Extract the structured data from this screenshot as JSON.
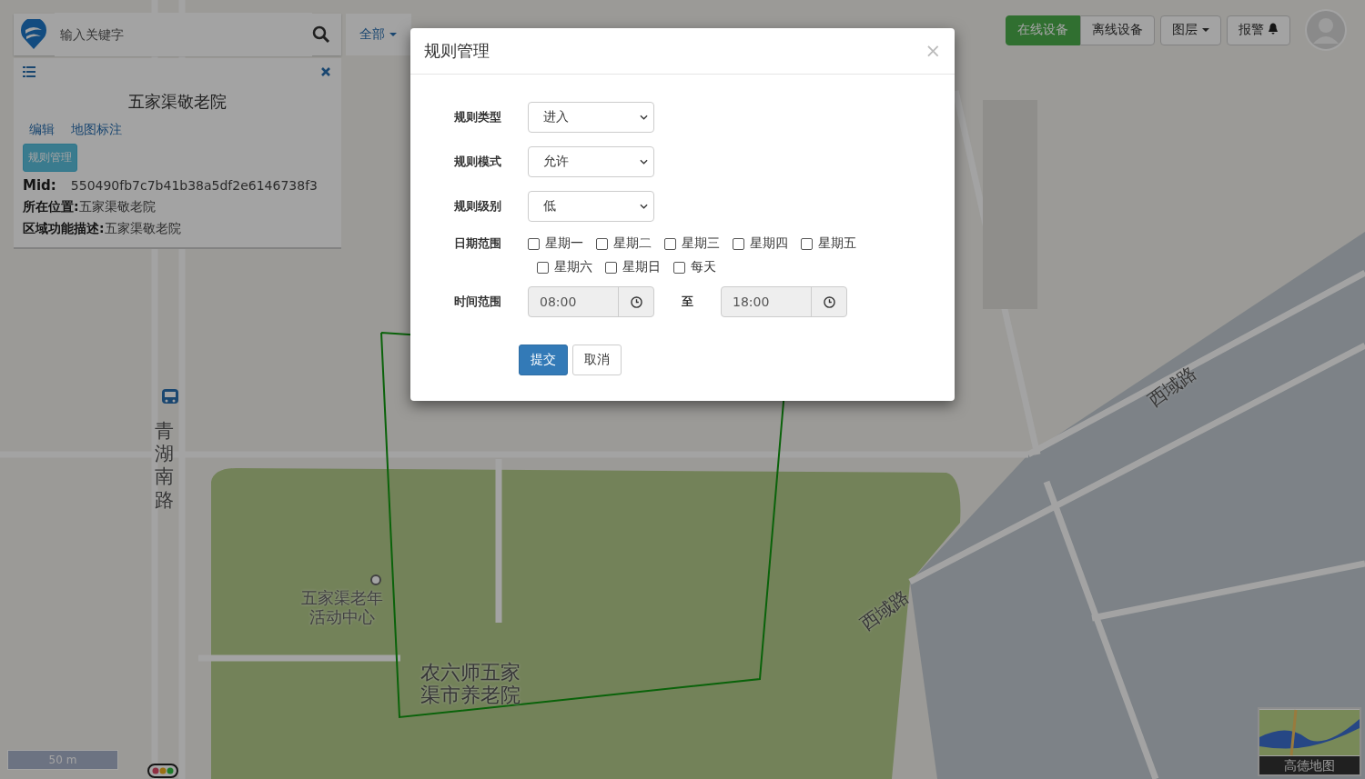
{
  "search": {
    "placeholder": "输入关键字",
    "filter": "全部"
  },
  "info_panel": {
    "title": "五家渠敬老院",
    "links": [
      "编辑",
      "地图标注"
    ],
    "rule_button": "规则管理",
    "fields": [
      {
        "kind": "mid",
        "label": "Mid:",
        "value": "550490fb7c7b41b38a5df2e6146738f3"
      },
      {
        "kind": "plain",
        "label": "所在位置:",
        "value": "五家渠敬老院"
      },
      {
        "kind": "plain",
        "label": "区域功能描述:",
        "value": "五家渠敬老院"
      }
    ]
  },
  "toolbar": {
    "device_tabs": [
      {
        "label": "在线设备",
        "selected": true
      },
      {
        "label": "离线设备",
        "selected": false
      }
    ],
    "layers": "图层",
    "alarm": "报警"
  },
  "map": {
    "labels": [
      {
        "kind": "vertical",
        "text": "青湖南路"
      },
      {
        "kind": "rotated",
        "text": "西域路"
      },
      {
        "kind": "rotated",
        "text": "西域路"
      },
      {
        "kind": "poi",
        "text": "五家渠老年活动中心"
      },
      {
        "kind": "place",
        "text": "农六师五家渠市养老院"
      }
    ],
    "scale": "50 m",
    "minimap": "高德地图"
  },
  "modal": {
    "title": "规则管理",
    "close": "×",
    "rows": [
      {
        "kind": "select",
        "label": "规则类型",
        "value": "进入"
      },
      {
        "kind": "select",
        "label": "规则模式",
        "value": "允许"
      },
      {
        "kind": "select",
        "label": "规则级别",
        "value": "低"
      },
      {
        "kind": "days",
        "label": "日期范围",
        "options": [
          {
            "label": "星期一",
            "checked": false
          },
          {
            "label": "星期二",
            "checked": false
          },
          {
            "label": "星期三",
            "checked": false
          },
          {
            "label": "星期四",
            "checked": false
          },
          {
            "label": "星期五",
            "checked": false
          },
          {
            "label": "星期六",
            "checked": false
          },
          {
            "label": "星期日",
            "checked": false
          },
          {
            "label": "每天",
            "checked": false
          }
        ]
      },
      {
        "kind": "time",
        "label": "时间范围",
        "start": "08:00",
        "separator": "至",
        "end": "18:00"
      }
    ],
    "submit": "提交",
    "cancel": "取消"
  }
}
